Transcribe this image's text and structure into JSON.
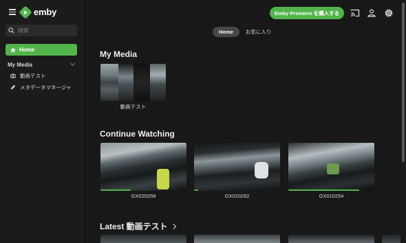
{
  "app": {
    "name": "emby"
  },
  "search": {
    "placeholder": "検索"
  },
  "nav": {
    "home_label": "Home",
    "section_label": "My Media",
    "items": [
      {
        "label": "動画テスト",
        "icon": "camera-icon"
      },
      {
        "label": "メタデータマネージャ",
        "icon": "pencil-icon"
      }
    ]
  },
  "header": {
    "premiere_label": "Emby Premiere を購入する",
    "icons": [
      "cast-icon",
      "user-icon",
      "settings-icon"
    ]
  },
  "tabs": [
    {
      "label": "Home",
      "active": true
    },
    {
      "label": "お気に入り",
      "active": false
    }
  ],
  "my_media": {
    "title": "My Media",
    "libraries": [
      {
        "name": "動画テスト"
      }
    ]
  },
  "continue_watching": {
    "title": "Continue Watching",
    "items": [
      {
        "title": "GX020258",
        "progress": 0.35
      },
      {
        "title": "GX020262",
        "progress": 0.05
      },
      {
        "title": "GX010254",
        "progress": 0.82
      }
    ]
  },
  "latest": {
    "title": "Latest 動画テスト"
  },
  "colors": {
    "accent": "#52b54b",
    "sidebar": "#1b1b1b",
    "main": "#181818"
  }
}
